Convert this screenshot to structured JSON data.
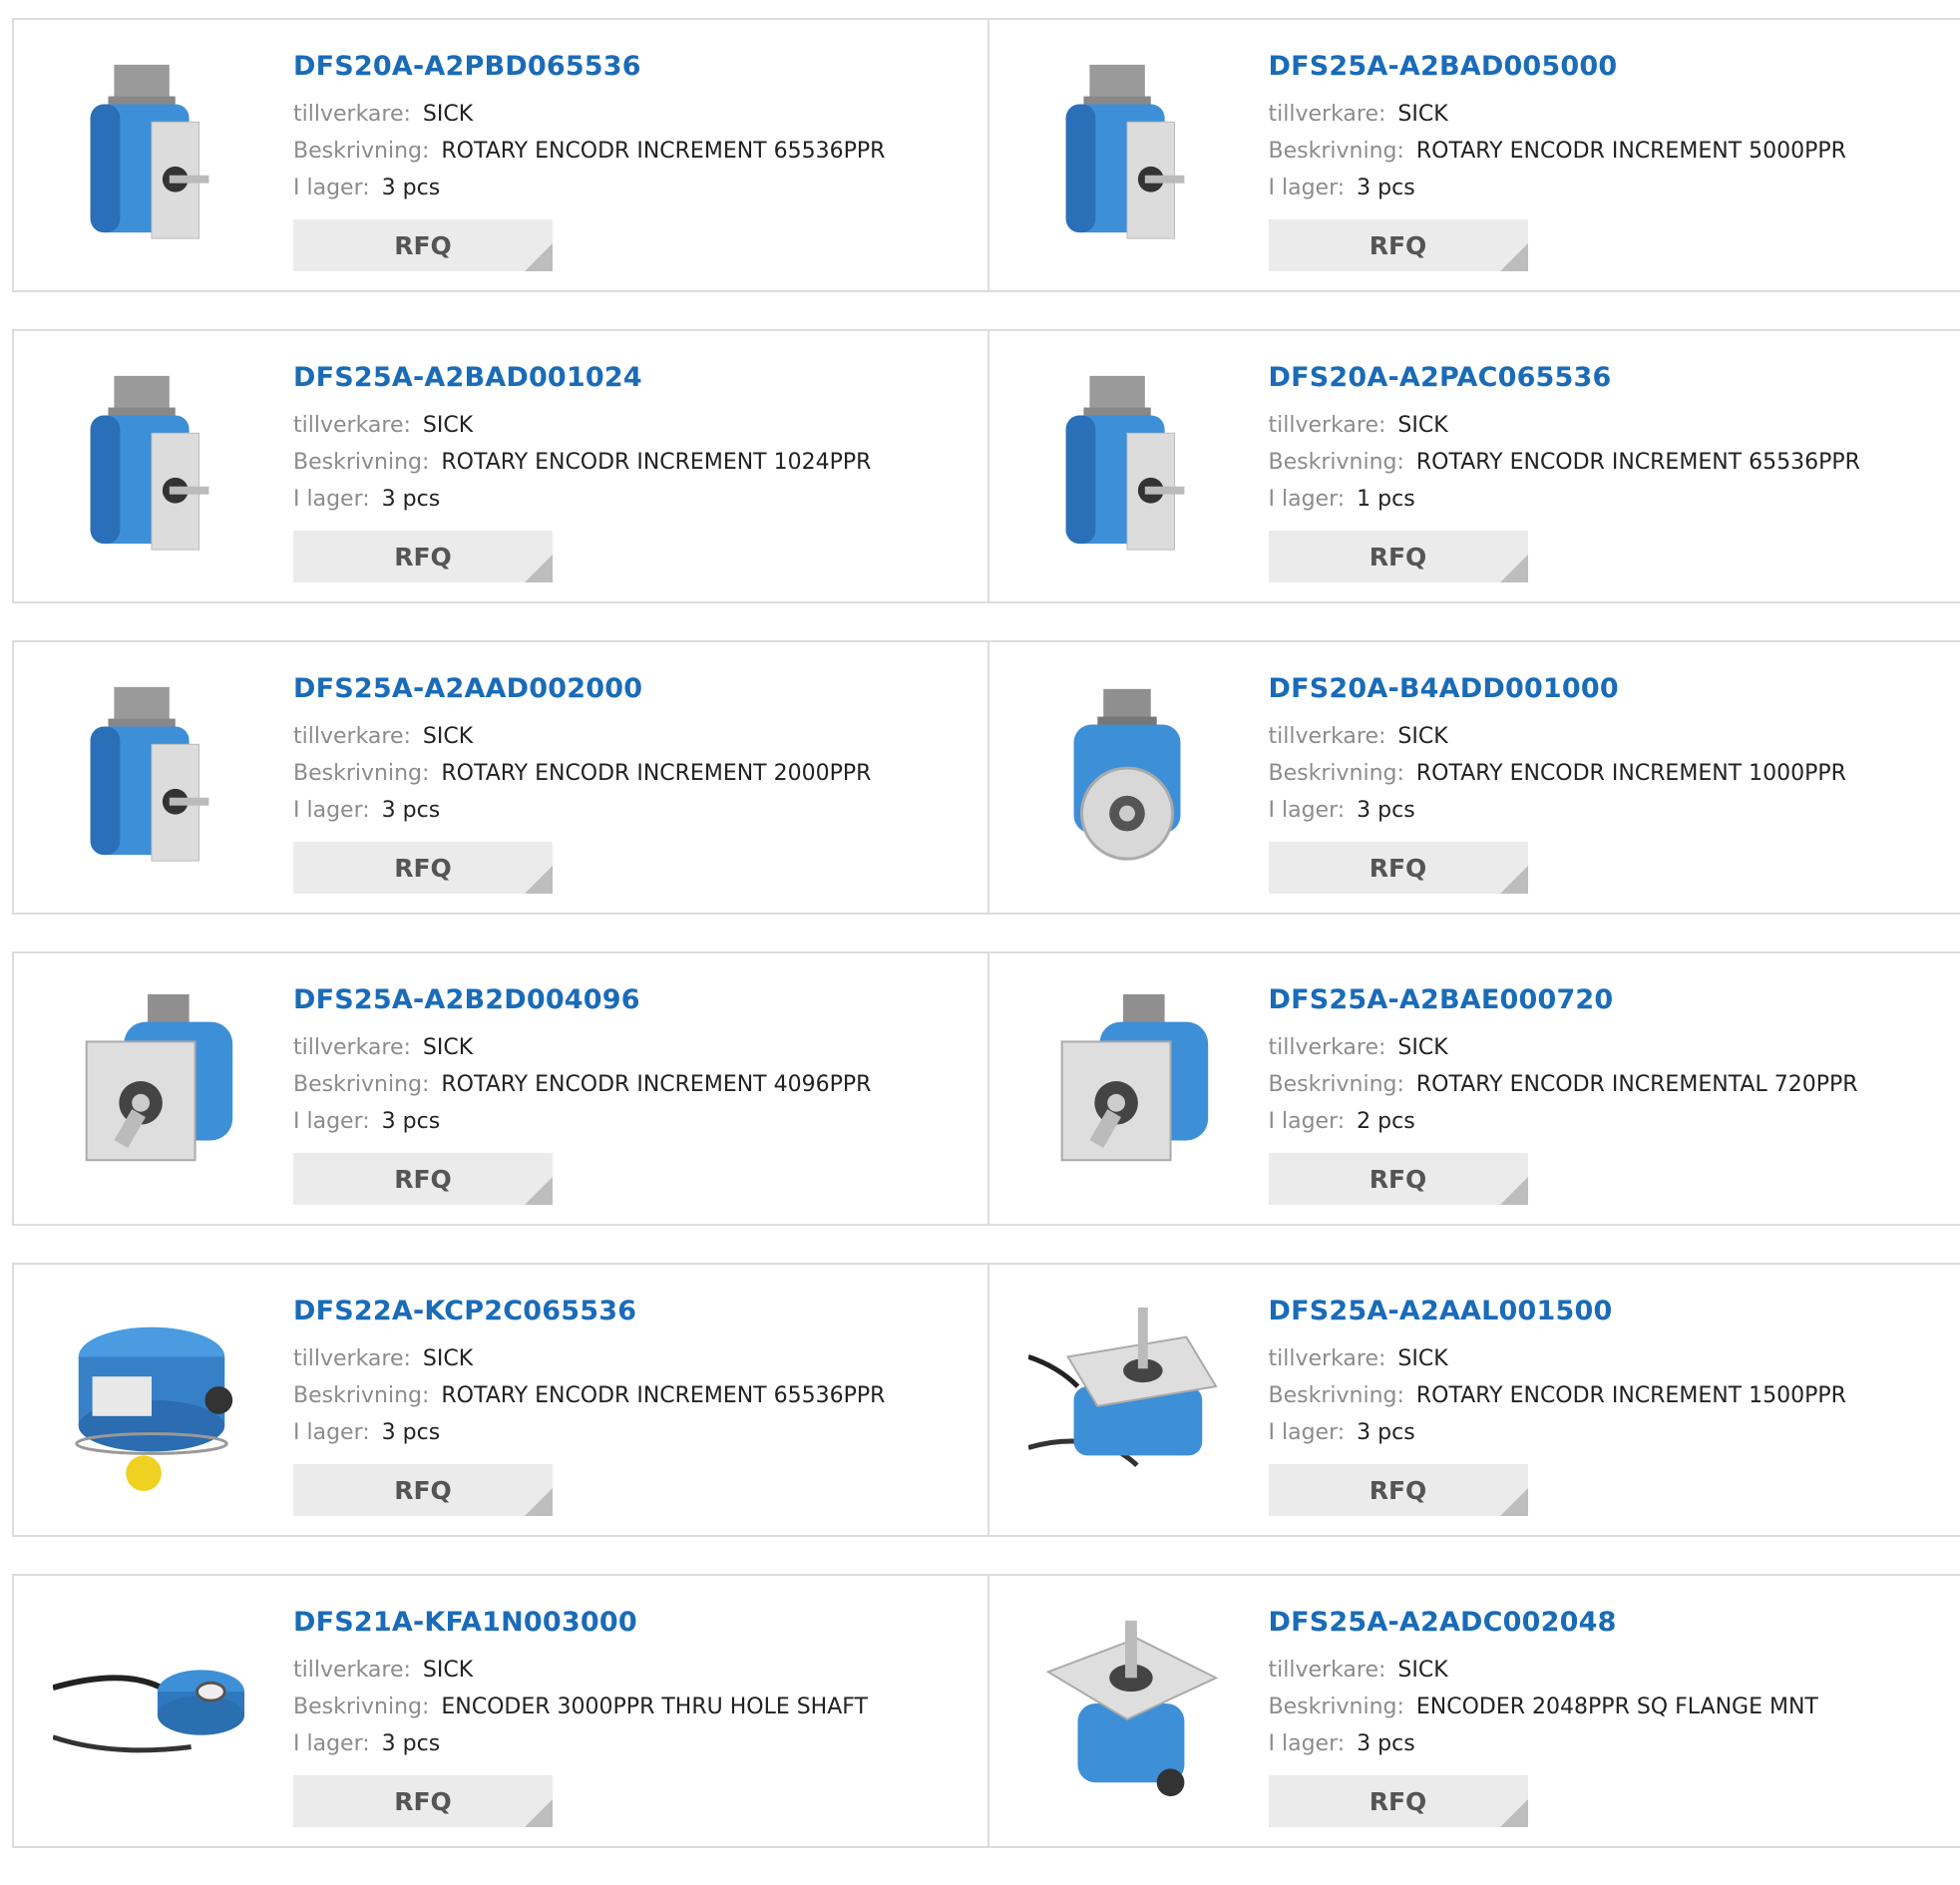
{
  "colors": {
    "part_link": "#1a6bb8",
    "label": "#8c8c8c",
    "value": "#222222",
    "rfq_bg": "#ebebeb",
    "border": "#dcdcdc"
  },
  "labels": {
    "manufacturer": "tillverkare:",
    "description": "Beskrivning:",
    "stock": "I lager:",
    "rfq": "RFQ"
  },
  "products": [
    {
      "part": "DFS20A-A2PBD065536",
      "manufacturer": "SICK",
      "description": "ROTARY ENCODR INCREMENT 65536PPR",
      "stock": "3 pcs",
      "image": "encoder-side-connector-icon"
    },
    {
      "part": "DFS25A-A2BAD005000",
      "manufacturer": "SICK",
      "description": "ROTARY ENCODR INCREMENT 5000PPR",
      "stock": "3 pcs",
      "image": "encoder-side-connector-icon"
    },
    {
      "part": "DFS25A-A2BAD001024",
      "manufacturer": "SICK",
      "description": "ROTARY ENCODR INCREMENT 1024PPR",
      "stock": "3 pcs",
      "image": "encoder-side-connector-icon"
    },
    {
      "part": "DFS20A-A2PAC065536",
      "manufacturer": "SICK",
      "description": "ROTARY ENCODR INCREMENT 65536PPR",
      "stock": "1 pcs",
      "image": "encoder-side-connector-icon"
    },
    {
      "part": "DFS25A-A2AAD002000",
      "manufacturer": "SICK",
      "description": "ROTARY ENCODR INCREMENT 2000PPR",
      "stock": "3 pcs",
      "image": "encoder-side-connector-icon"
    },
    {
      "part": "DFS20A-B4ADD001000",
      "manufacturer": "SICK",
      "description": "ROTARY ENCODR INCREMENT 1000PPR",
      "stock": "3 pcs",
      "image": "encoder-round-flange-icon"
    },
    {
      "part": "DFS25A-A2B2D004096",
      "manufacturer": "SICK",
      "description": "ROTARY ENCODR INCREMENT 4096PPR",
      "stock": "3 pcs",
      "image": "encoder-square-flange-icon"
    },
    {
      "part": "DFS25A-A2BAE000720",
      "manufacturer": "SICK",
      "description": "ROTARY ENCODR INCREMENTAL 720PPR",
      "stock": "2 pcs",
      "image": "encoder-square-flange-icon"
    },
    {
      "part": "DFS22A-KCP2C065536",
      "manufacturer": "SICK",
      "description": "ROTARY ENCODR INCREMENT 65536PPR",
      "stock": "3 pcs",
      "image": "encoder-hollow-shaft-icon"
    },
    {
      "part": "DFS25A-A2AAL001500",
      "manufacturer": "SICK",
      "description": "ROTARY ENCODR INCREMENT 1500PPR",
      "stock": "3 pcs",
      "image": "encoder-cable-top-icon"
    },
    {
      "part": "DFS21A-KFA1N003000",
      "manufacturer": "SICK",
      "description": "ENCODER 3000PPR THRU HOLE SHAFT",
      "stock": "3 pcs",
      "image": "encoder-through-hole-cable-icon"
    },
    {
      "part": "DFS25A-A2ADC002048",
      "manufacturer": "SICK",
      "description": "ENCODER 2048PPR SQ FLANGE MNT",
      "stock": "3 pcs",
      "image": "encoder-square-top-icon"
    }
  ]
}
